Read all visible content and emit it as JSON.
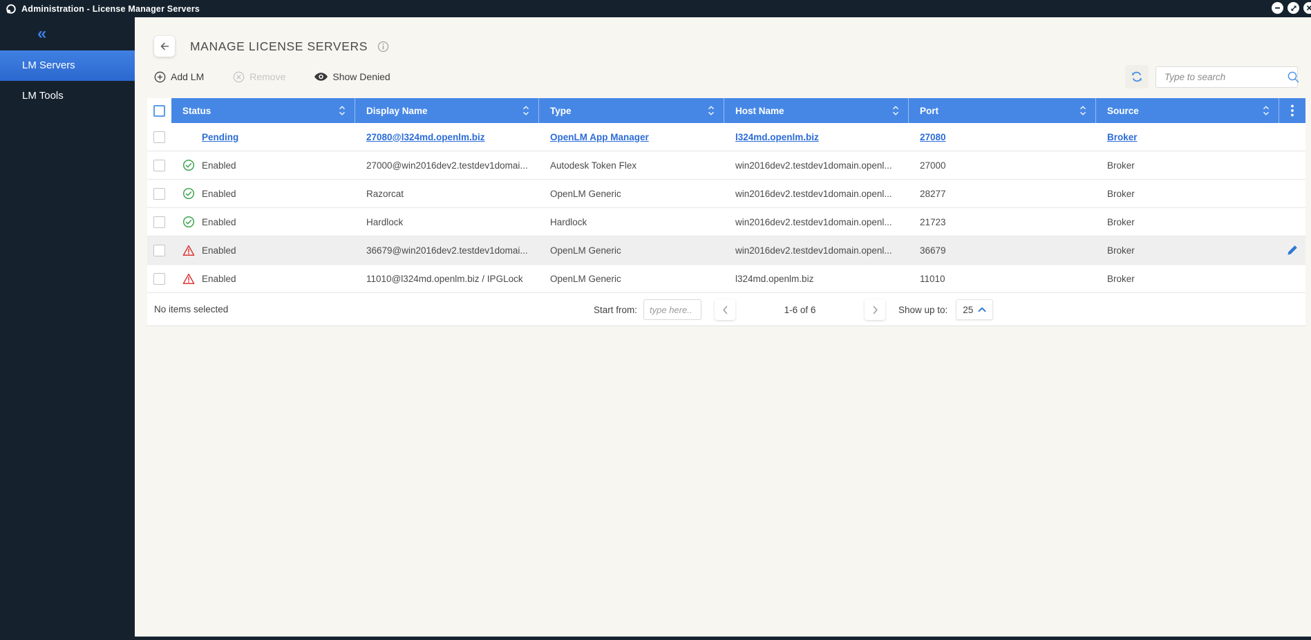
{
  "window": {
    "title": "Administration - License Manager Servers",
    "buttons": [
      "minimize",
      "maximize",
      "close"
    ]
  },
  "sidebar": {
    "collapse_icon": "chevron-double-left",
    "items": [
      {
        "label": "LM Servers",
        "active": true
      },
      {
        "label": "LM Tools",
        "active": false
      }
    ]
  },
  "page": {
    "title": "MANAGE LICENSE SERVERS",
    "info_icon": "info-circle"
  },
  "toolbar": {
    "add_label": "Add LM",
    "remove_label": "Remove",
    "show_denied_label": "Show Denied",
    "search_placeholder": "Type to search"
  },
  "table": {
    "columns": [
      {
        "label": "Status"
      },
      {
        "label": "Display Name"
      },
      {
        "label": "Type"
      },
      {
        "label": "Host Name"
      },
      {
        "label": "Port"
      },
      {
        "label": "Source"
      }
    ],
    "rows": [
      {
        "status": "Pending",
        "display_name": "27080@l324md.openlm.biz",
        "type": "OpenLM App Manager",
        "host_name": "l324md.openlm.biz",
        "port": "27080",
        "source": "Broker",
        "status_icon": "none",
        "link_row": true,
        "highlighted": false,
        "edit_visible": false
      },
      {
        "status": "Enabled",
        "display_name": "27000@win2016dev2.testdev1domai...",
        "type": "Autodesk Token Flex",
        "host_name": "win2016dev2.testdev1domain.openl...",
        "port": "27000",
        "source": "Broker",
        "status_icon": "enabled-check",
        "link_row": false,
        "highlighted": false,
        "edit_visible": false
      },
      {
        "status": "Enabled",
        "display_name": "Razorcat",
        "type": "OpenLM Generic",
        "host_name": "win2016dev2.testdev1domain.openl...",
        "port": "28277",
        "source": "Broker",
        "status_icon": "enabled-check",
        "link_row": false,
        "highlighted": false,
        "edit_visible": false
      },
      {
        "status": "Enabled",
        "display_name": "Hardlock",
        "type": "Hardlock",
        "host_name": "win2016dev2.testdev1domain.openl...",
        "port": "21723",
        "source": "Broker",
        "status_icon": "enabled-check",
        "link_row": false,
        "highlighted": false,
        "edit_visible": false
      },
      {
        "status": "Enabled",
        "display_name": "36679@win2016dev2.testdev1domai...",
        "type": "OpenLM Generic",
        "host_name": "win2016dev2.testdev1domain.openl...",
        "port": "36679",
        "source": "Broker",
        "status_icon": "warning",
        "link_row": false,
        "highlighted": true,
        "edit_visible": true
      },
      {
        "status": "Enabled",
        "display_name": "11010@l324md.openlm.biz / IPGLock",
        "type": "OpenLM Generic",
        "host_name": "l324md.openlm.biz",
        "port": "11010",
        "source": "Broker",
        "status_icon": "warning",
        "link_row": false,
        "highlighted": false,
        "edit_visible": false
      }
    ]
  },
  "footer": {
    "selection_text": "No items selected",
    "start_from_label": "Start from:",
    "start_from_placeholder": "type here..",
    "range_text": "1-6 of 6",
    "show_up_to_label": "Show up to:",
    "page_size": "25"
  },
  "colors": {
    "titlebar": "#15222e",
    "sidebar": "#15222e",
    "active_nav_blue": "#3273dd",
    "table_header_blue": "#4687e6",
    "link_blue": "#2b6cd8",
    "enabled_green": "#3fa553",
    "warning_red": "#dc3838",
    "accent_blue": "#4a90e2",
    "background": "#f8f6f1",
    "row_highlight": "#efefef"
  }
}
